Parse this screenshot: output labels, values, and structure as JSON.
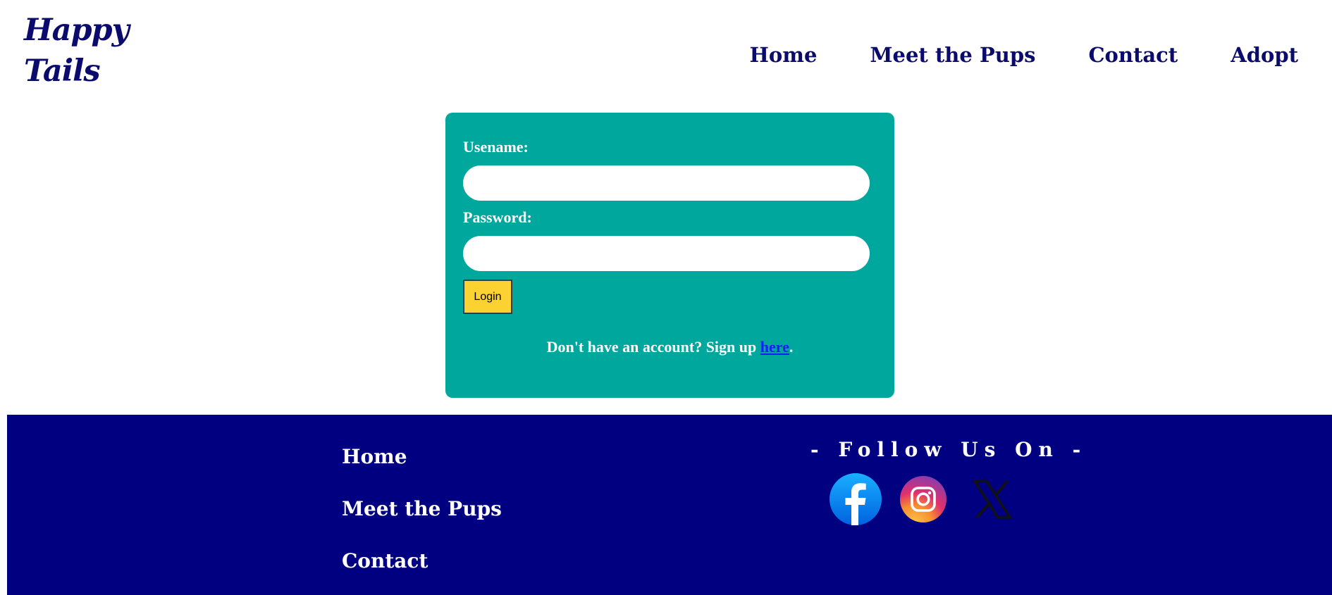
{
  "header": {
    "logo_line1": "Happy",
    "logo_line2": "Tails",
    "nav": [
      "Home",
      "Meet the Pups",
      "Contact",
      "Adopt"
    ]
  },
  "login": {
    "username_label": "Usename:",
    "password_label": "Password:",
    "username_value": "",
    "password_value": "",
    "login_button": "Login",
    "signup_prefix": "Don't have an account? Sign up ",
    "signup_link": "here",
    "signup_suffix": "."
  },
  "footer": {
    "links": [
      "Home",
      "Meet the Pups",
      "Contact"
    ],
    "follow_title": "- Follow Us On -",
    "social": [
      {
        "icon": "facebook-icon"
      },
      {
        "icon": "instagram-icon"
      },
      {
        "icon": "x-twitter-icon"
      }
    ]
  },
  "colors": {
    "brand_navy": "#0b0b6e",
    "card_teal": "#00a79d",
    "button_yellow": "#fcd232",
    "footer_navy": "#000080",
    "link_blue": "#1a1aff"
  }
}
